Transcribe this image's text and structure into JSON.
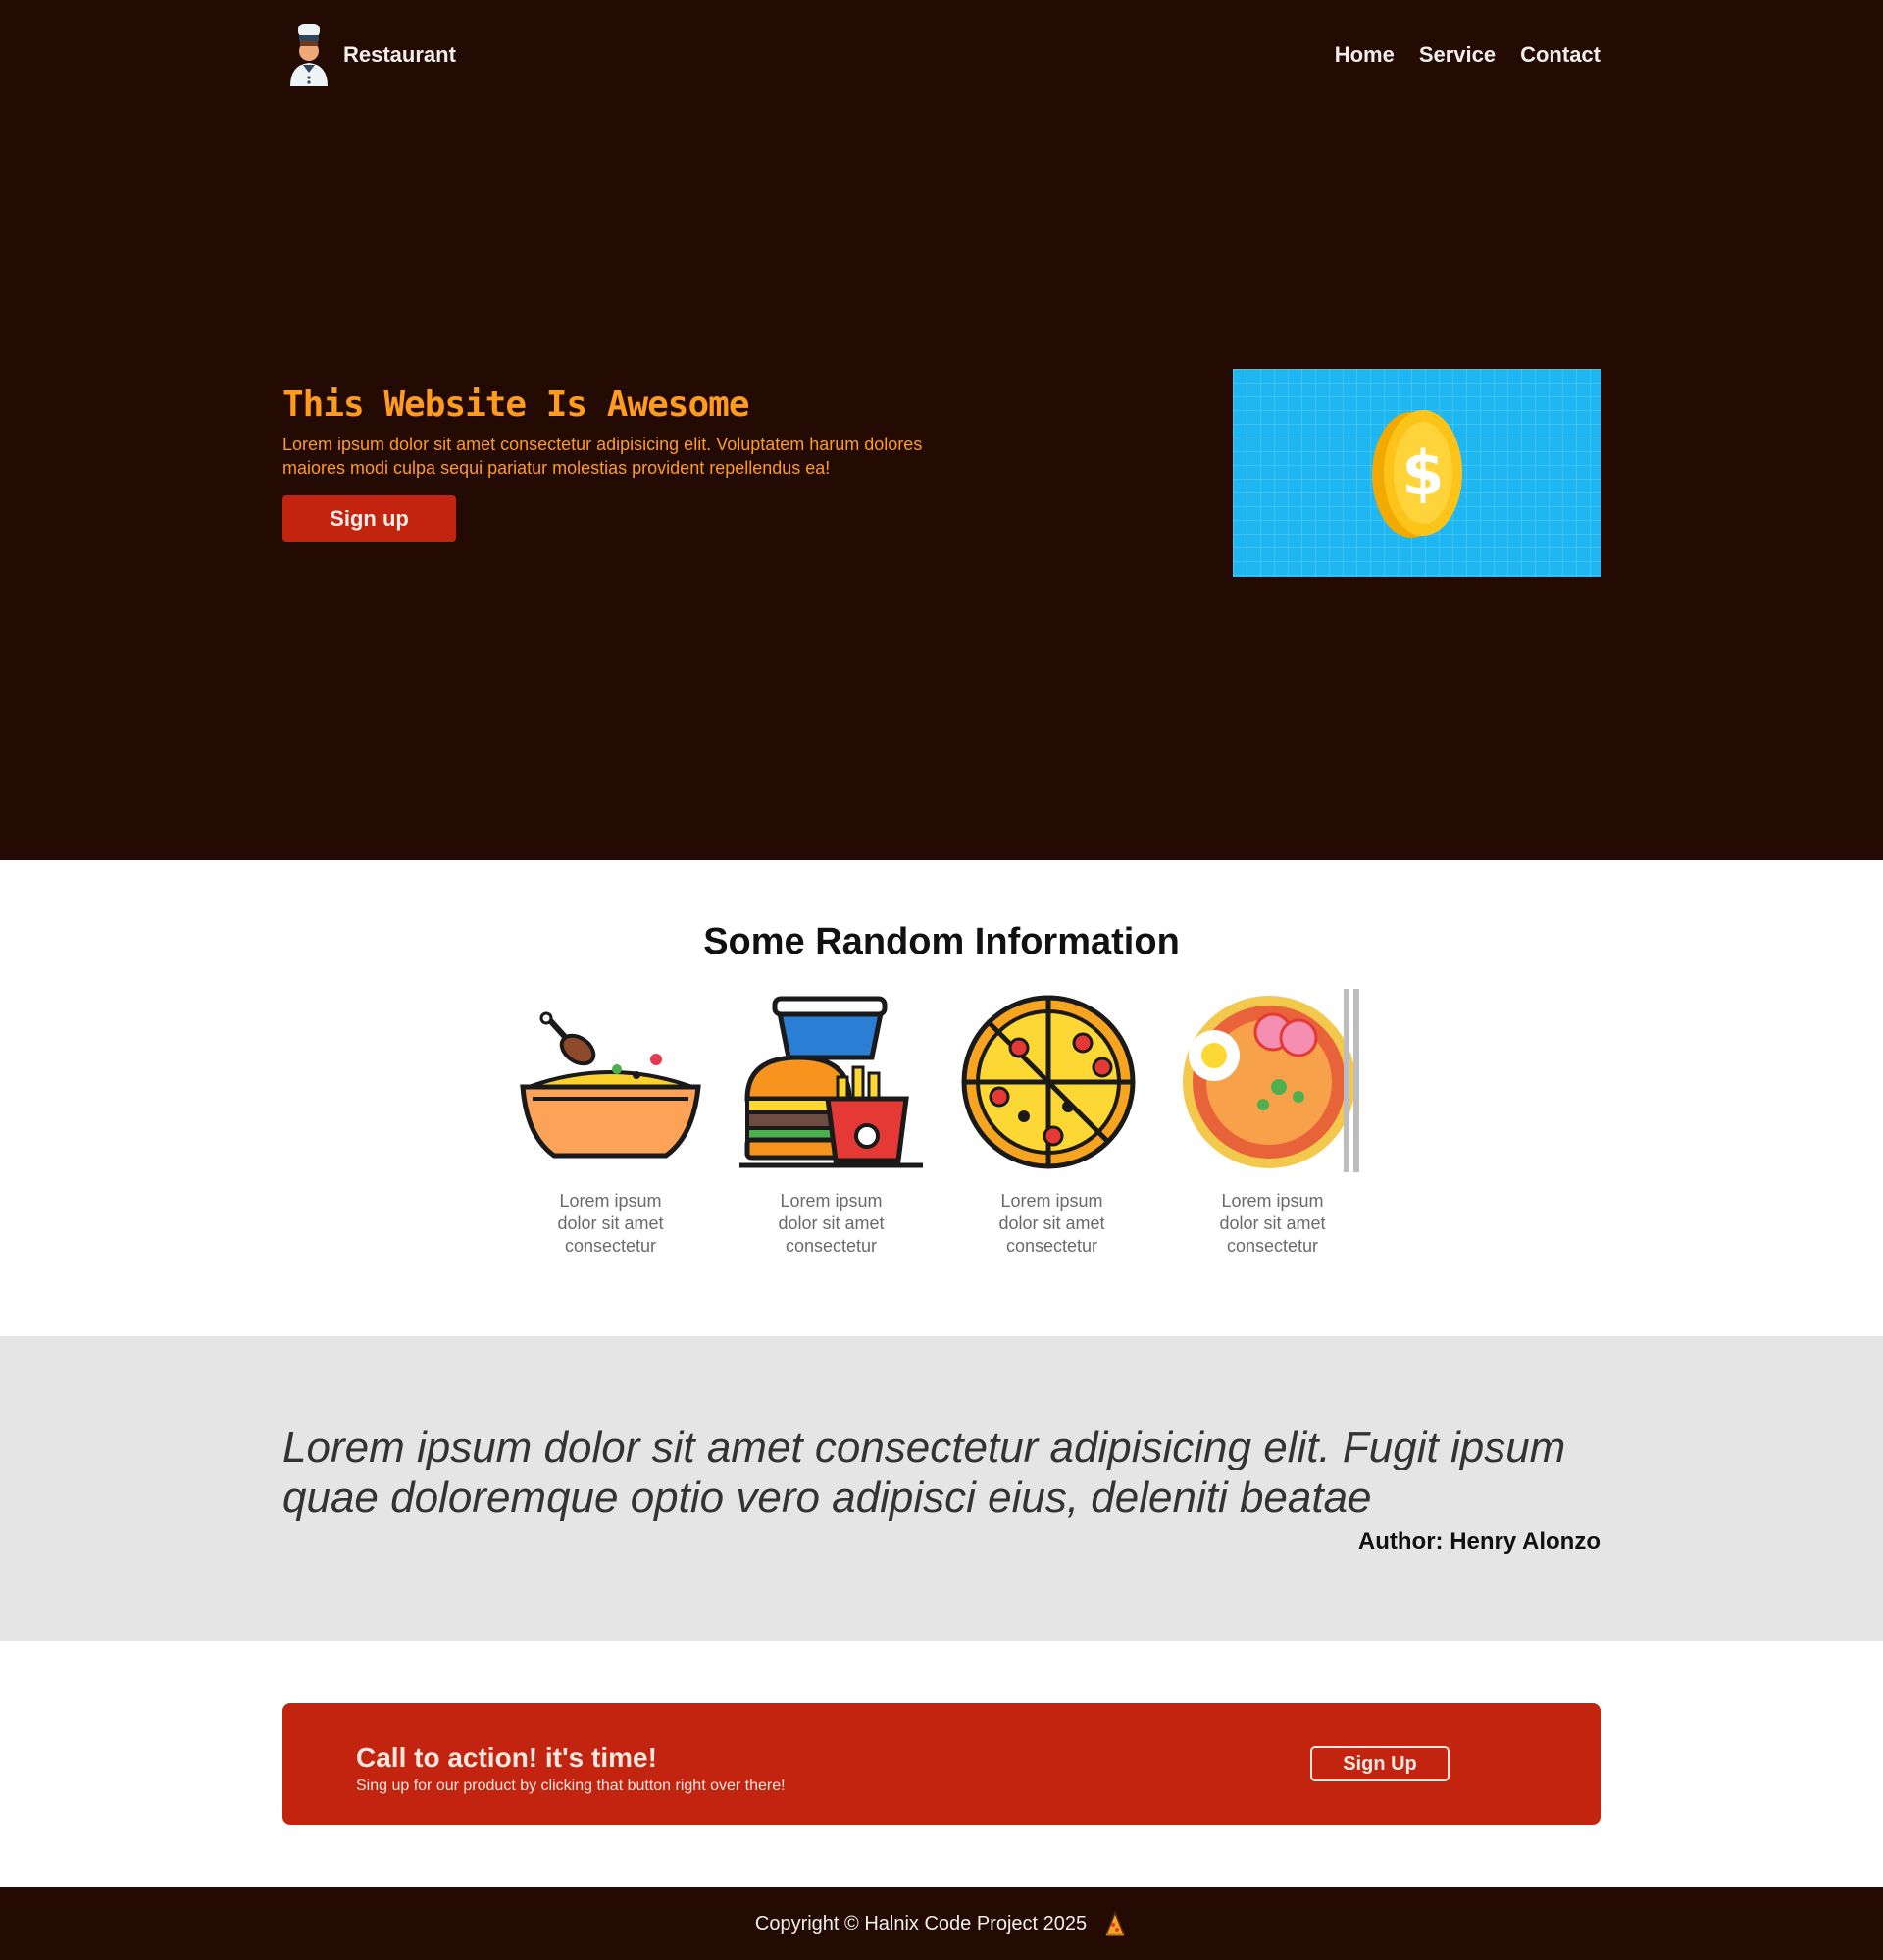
{
  "nav": {
    "brand": "Restaurant",
    "links": [
      "Home",
      "Service",
      "Contact"
    ]
  },
  "hero": {
    "title": "This Website Is Awesome",
    "description": "Lorem ipsum dolor sit amet consectetur adipisicing elit. Voluptatem harum dolores maiores modi culpa sequi pariatur molestias provident repellendus ea!",
    "button": "Sign up",
    "image_icon": "coin-icon"
  },
  "info": {
    "title": "Some Random Information",
    "items": [
      {
        "icon": "rice-bowl-icon",
        "text": "Lorem ipsum dolor sit amet consectetur"
      },
      {
        "icon": "burger-fries-icon",
        "text": "Lorem ipsum dolor sit amet consectetur"
      },
      {
        "icon": "pizza-icon",
        "text": "Lorem ipsum dolor sit amet consectetur"
      },
      {
        "icon": "ramen-icon",
        "text": "Lorem ipsum dolor sit amet consectetur"
      }
    ]
  },
  "quote": {
    "text": "Lorem ipsum dolor sit amet consectetur adipisicing elit. Fugit ipsum quae doloremque optio vero adipisci eius, deleniti beatae",
    "author": "Author: Henry Alonzo"
  },
  "cta": {
    "title": "Call to action! it's time!",
    "subtitle": "Sing up for our product by clicking that button right over there!",
    "button": "Sign Up"
  },
  "footer": {
    "text": "Copyright © Halnix Code Project 2025"
  },
  "colors": {
    "dark": "#230b03",
    "accent": "#ff9b1f",
    "red": "#c2240f",
    "quote_bg": "#e6e5e6"
  }
}
